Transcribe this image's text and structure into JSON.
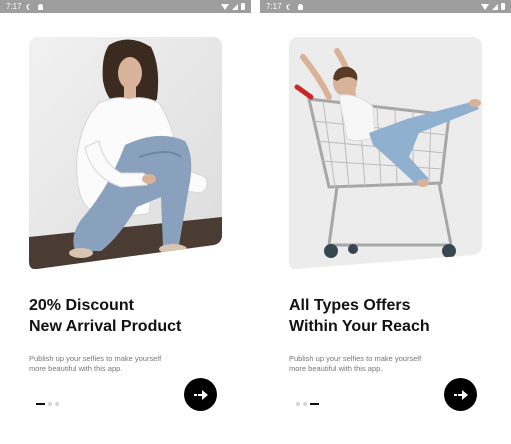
{
  "status_bar": {
    "time": "7:17",
    "icons": [
      "moon-icon",
      "bell-icon",
      "wifi-icon",
      "signal-icon",
      "battery-icon"
    ],
    "color": "#9e9e9e"
  },
  "screens": [
    {
      "title_line1": "20% Discount",
      "title_line2": "New Arrival Product",
      "desc_line1": "Publish up your selfies to make yourself",
      "desc_line2": "more beautiful with this app.",
      "page_index": 0,
      "page_count": 3,
      "image": "model-sitting-photo",
      "next_icon": "arrow-right-icon"
    },
    {
      "title_line1": "All Types Offers",
      "title_line2": "Within Your Reach",
      "desc_line1": "Publish up your selfies to make yourself",
      "desc_line2": "more beautiful with this app.",
      "page_index": 2,
      "page_count": 3,
      "image": "shopping-cart-photo",
      "next_icon": "arrow-right-icon"
    }
  ],
  "colors": {
    "title": "#111111",
    "description": "#777777",
    "button": "#000000",
    "indicator_active": "#111111",
    "indicator_inactive": "#d4d4d4"
  }
}
